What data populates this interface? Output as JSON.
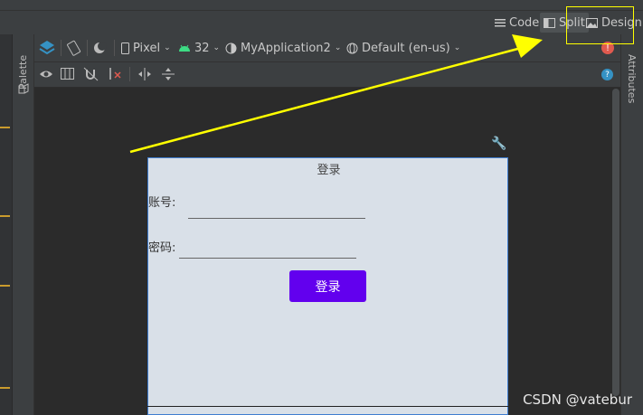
{
  "header": {
    "modes": [
      {
        "label": "Code",
        "icon": "code-lines-icon"
      },
      {
        "label": "Split",
        "icon": "split-view-icon"
      },
      {
        "label": "Design",
        "icon": "image-icon"
      }
    ]
  },
  "palette": {
    "label": "Palette"
  },
  "attributes": {
    "label": "Attributes"
  },
  "toolbar": {
    "device": "Pixel",
    "api": "32",
    "theme": "MyApplication2",
    "locale": "Default (en-us)"
  },
  "phone": {
    "title": "登录",
    "account_label": "账号:",
    "password_label": "密码:",
    "login_button": "登录"
  },
  "watermark": "CSDN @vatebur",
  "colors": {
    "button": "#6200ee",
    "highlight": "#ffff00",
    "phone_bg": "#d9e0e8",
    "android_green": "#3ddc84",
    "error_red": "#e05a4f",
    "help_blue": "#3592c4"
  }
}
